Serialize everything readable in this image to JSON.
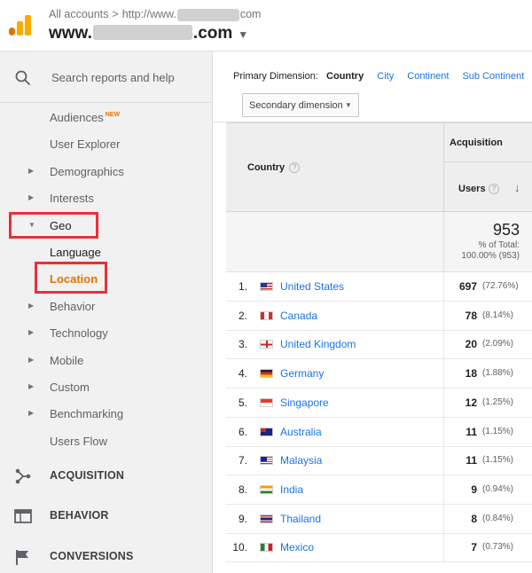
{
  "header": {
    "breadcrumb_root": "All accounts",
    "breadcrumb_sep": ">",
    "breadcrumb_url_prefix": "http://www.",
    "breadcrumb_url_suffix": "com",
    "site_prefix": "www.",
    "site_suffix": ".com",
    "site_caret": "▼"
  },
  "sidebar": {
    "search_placeholder": "Search reports and help",
    "items": [
      {
        "label": "Audiences",
        "badge": "NEW"
      },
      {
        "label": "User Explorer"
      },
      {
        "label": "Demographics"
      },
      {
        "label": "Interests"
      },
      {
        "label": "Geo"
      },
      {
        "label": "Language"
      },
      {
        "label": "Location"
      },
      {
        "label": "Behavior"
      },
      {
        "label": "Technology"
      },
      {
        "label": "Mobile"
      },
      {
        "label": "Custom"
      },
      {
        "label": "Benchmarking"
      },
      {
        "label": "Users Flow"
      }
    ],
    "sections": [
      {
        "label": "ACQUISITION",
        "icon": "acquisition-icon"
      },
      {
        "label": "BEHAVIOR",
        "icon": "behavior-icon"
      },
      {
        "label": "CONVERSIONS",
        "icon": "flag-icon"
      }
    ]
  },
  "dimensions": {
    "prefix": "Primary Dimension:",
    "active": "Country",
    "options": [
      "City",
      "Continent",
      "Sub Continent"
    ],
    "secondary_button": "Secondary dimension"
  },
  "table": {
    "col_country": "Country",
    "col_group": "Acquisition",
    "col_users": "Users",
    "help_glyph": "?",
    "sort_glyph": "↓",
    "total_value": "953",
    "total_line1": "% of Total:",
    "total_line2": "100.00% (953)",
    "rows": [
      {
        "rank": "1.",
        "country": "United States",
        "users": "697",
        "pct": "(72.76%)",
        "flag": "us"
      },
      {
        "rank": "2.",
        "country": "Canada",
        "users": "78",
        "pct": "(8.14%)",
        "flag": "ca"
      },
      {
        "rank": "3.",
        "country": "United Kingdom",
        "users": "20",
        "pct": "(2.09%)",
        "flag": "gb"
      },
      {
        "rank": "4.",
        "country": "Germany",
        "users": "18",
        "pct": "(1.88%)",
        "flag": "de"
      },
      {
        "rank": "5.",
        "country": "Singapore",
        "users": "12",
        "pct": "(1.25%)",
        "flag": "sg"
      },
      {
        "rank": "6.",
        "country": "Australia",
        "users": "11",
        "pct": "(1.15%)",
        "flag": "au"
      },
      {
        "rank": "7.",
        "country": "Malaysia",
        "users": "11",
        "pct": "(1.15%)",
        "flag": "my"
      },
      {
        "rank": "8.",
        "country": "India",
        "users": "9",
        "pct": "(0.94%)",
        "flag": "in"
      },
      {
        "rank": "9.",
        "country": "Thailand",
        "users": "8",
        "pct": "(0.84%)",
        "flag": "th"
      },
      {
        "rank": "10.",
        "country": "Mexico",
        "users": "7",
        "pct": "(0.73%)",
        "flag": "mx"
      }
    ]
  },
  "colors": {
    "accent": "#e37400",
    "link": "#1a73e8",
    "highlight_box": "#e8303a"
  }
}
